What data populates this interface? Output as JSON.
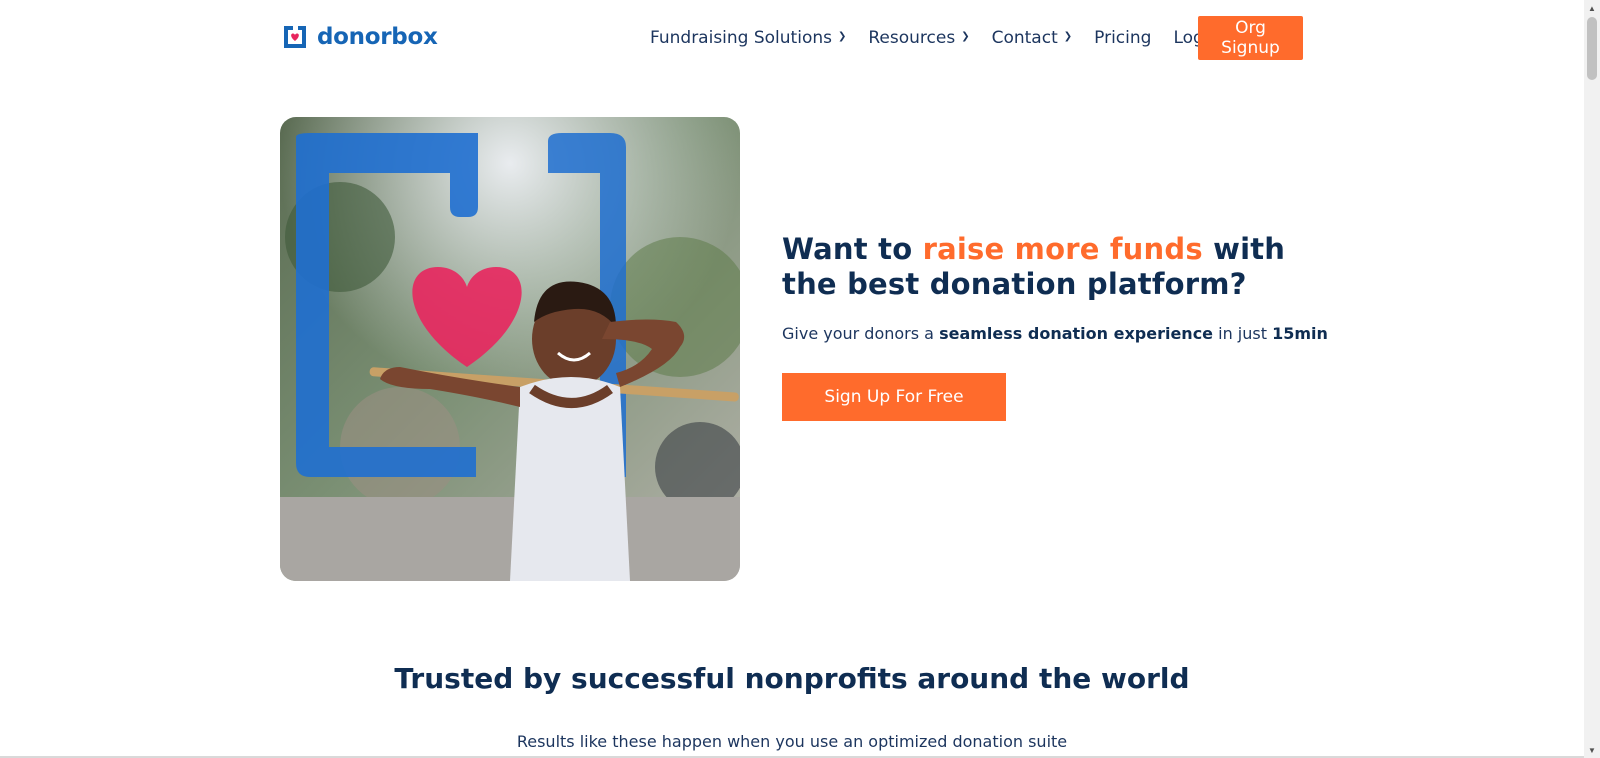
{
  "brand": {
    "name": "donorbox",
    "color": "#1665b5",
    "accent": "#ff6b2c"
  },
  "nav": {
    "items": [
      {
        "label": "Fundraising Solutions",
        "dropdown": true
      },
      {
        "label": "Resources",
        "dropdown": true
      },
      {
        "label": "Contact",
        "dropdown": true
      },
      {
        "label": "Pricing",
        "dropdown": false
      },
      {
        "label": "Login",
        "dropdown": true
      }
    ],
    "signup_label": "Org Signup"
  },
  "hero": {
    "headline_part1": "Want to ",
    "headline_highlight": "raise more funds",
    "headline_part2": " with the best donation platform?",
    "sub_part1": "Give your donors a ",
    "sub_bold1": "seamless donation experience",
    "sub_part2": " in just ",
    "sub_bold2": "15min",
    "cta_label": "Sign Up For Free"
  },
  "trusted": {
    "title": "Trusted by successful nonprofits around the world",
    "subtitle": "Results like these happen when you use an optimized donation suite"
  }
}
